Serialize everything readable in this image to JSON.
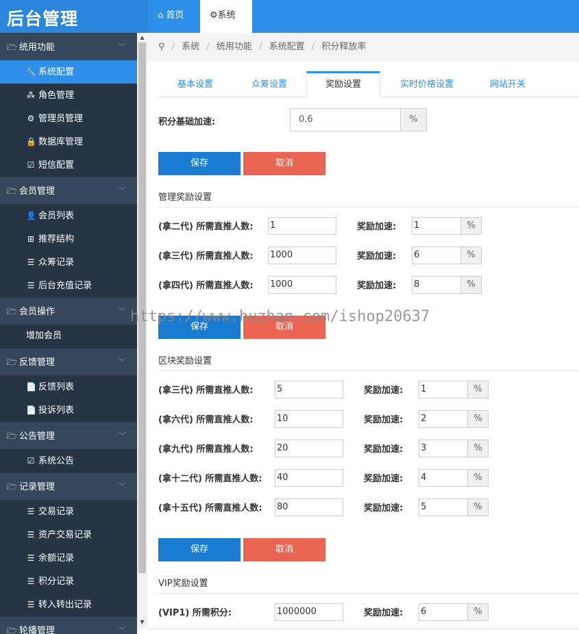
{
  "app": {
    "title": "后台管理"
  },
  "topnav": {
    "home": "首页",
    "system": "系统"
  },
  "sidebar": {
    "groups": [
      {
        "label": "统用功能",
        "items": [
          "系统配置",
          "角色管理",
          "管理员管理",
          "数据库管理",
          "短信配置"
        ]
      },
      {
        "label": "会员管理",
        "items": [
          "会员列表",
          "推荐结构",
          "众筹记录",
          "后台充值记录"
        ]
      },
      {
        "label": "会员操作",
        "items": [
          "增加会员"
        ]
      },
      {
        "label": "反馈管理",
        "items": [
          "反馈列表",
          "投诉列表"
        ]
      },
      {
        "label": "公告管理",
        "items": [
          "系统公告"
        ]
      },
      {
        "label": "记录管理",
        "items": [
          "交易记录",
          "资产交易记录",
          "余额记录",
          "积分记录",
          "转入转出记录"
        ]
      },
      {
        "label": "轮播管理"
      }
    ]
  },
  "breadcrumb": [
    "系统",
    "统用功能",
    "系统配置",
    "积分释放率"
  ],
  "tabs": [
    "基本设置",
    "众筹设置",
    "奖励设置",
    "实时价格设置",
    "网站开关"
  ],
  "form": {
    "base_label": "积分基础加速:",
    "base_value": "0.6",
    "unit": "%",
    "save": "保存",
    "cancel": "取消",
    "reward_label": "奖励加速:",
    "manage_title": "管理奖励设置",
    "manage_rows": [
      {
        "label": "(拿二代) 所需直推人数:",
        "count": "1",
        "rate": "1"
      },
      {
        "label": "(拿三代) 所需直推人数:",
        "count": "1000",
        "rate": "6"
      },
      {
        "label": "(拿四代) 所需直推人数:",
        "count": "1000",
        "rate": "8"
      }
    ],
    "block_title": "区块奖励设置",
    "block_rows": [
      {
        "label": "(拿三代) 所需直推人数:",
        "count": "5",
        "rate": "1"
      },
      {
        "label": "(拿六代) 所需直推人数:",
        "count": "10",
        "rate": "2"
      },
      {
        "label": "(拿九代) 所需直推人数:",
        "count": "20",
        "rate": "3"
      },
      {
        "label": "(拿十二代) 所需直推人数:",
        "count": "40",
        "rate": "4"
      },
      {
        "label": "(拿十五代) 所需直推人数:",
        "count": "80",
        "rate": "5"
      }
    ],
    "vip_title": "VIP奖励设置",
    "vip_rows": [
      {
        "label": "(VIP1) 所需积分:",
        "count": "1000000",
        "rate": "6"
      }
    ]
  },
  "watermark": "https://www.huzhan.com/ishop20637"
}
